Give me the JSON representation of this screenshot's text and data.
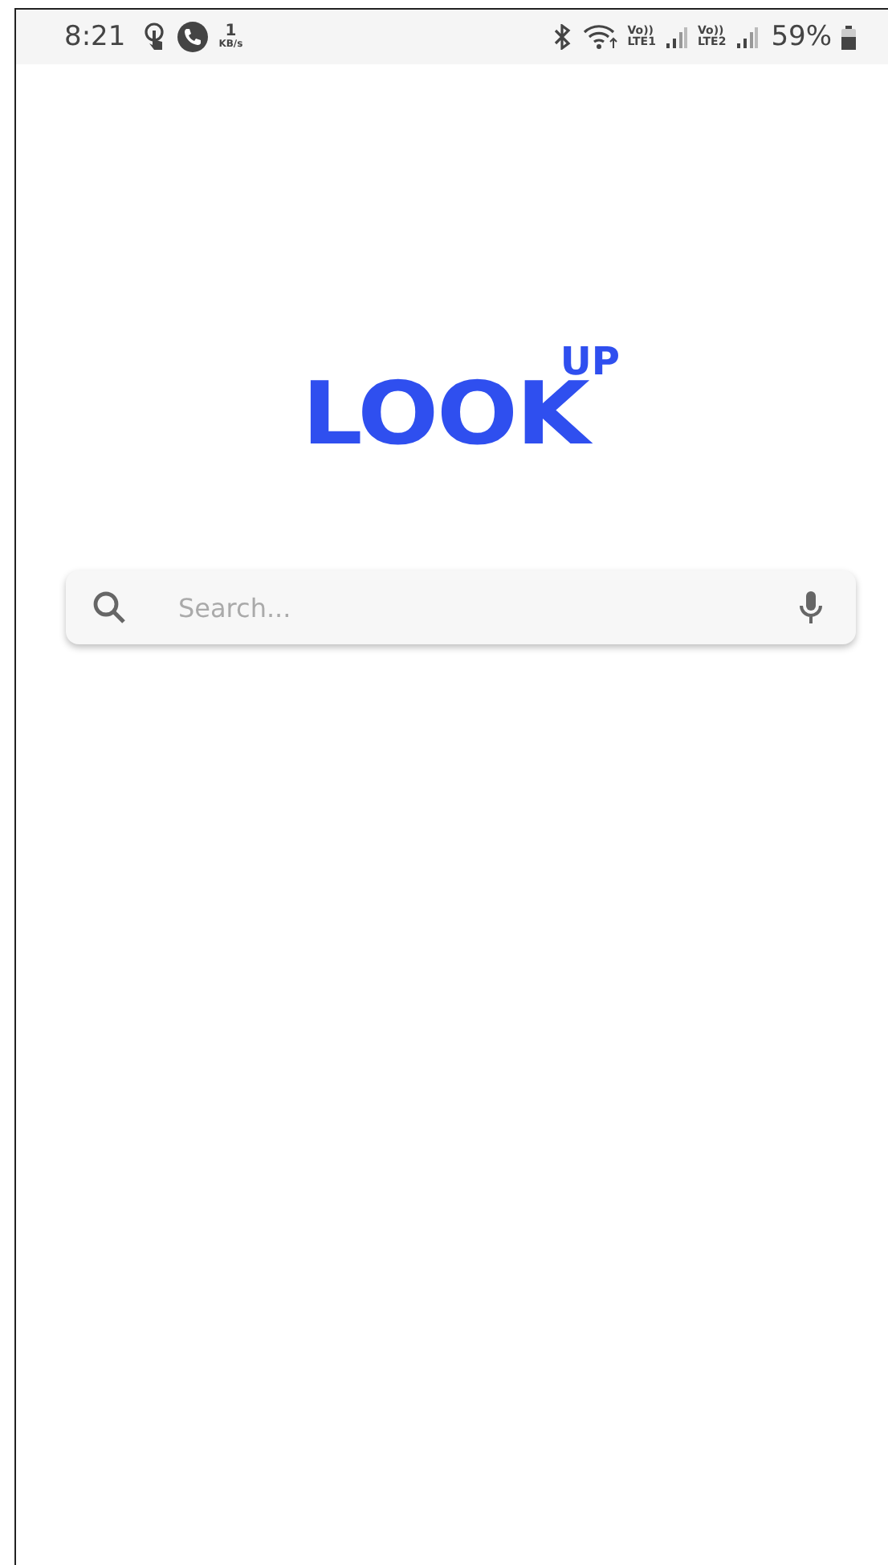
{
  "status_bar": {
    "time": "8:21",
    "net_speed": "1",
    "net_unit": "KB/s",
    "sims": [
      {
        "voice": "Vo))",
        "label": "LTE1"
      },
      {
        "voice": "Vo))",
        "label": "LTE2"
      }
    ],
    "battery": "59%"
  },
  "logo": {
    "main": "LOOK",
    "superscript": "UP"
  },
  "search": {
    "placeholder": "Search..."
  }
}
